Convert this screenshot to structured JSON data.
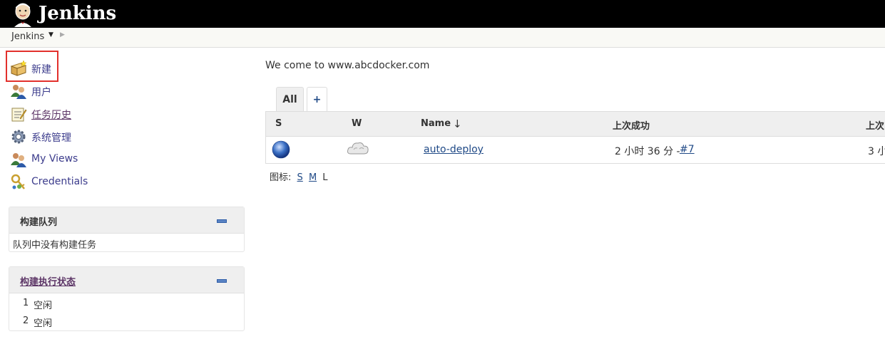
{
  "header": {
    "brand": "Jenkins",
    "logo_icon": "jenkins-butler-logo"
  },
  "breadcrumb": {
    "home": "Jenkins"
  },
  "tasks": [
    {
      "label": "新建",
      "icon": "new-item-icon"
    },
    {
      "label": "用户",
      "icon": "users-icon"
    },
    {
      "label": "任务历史",
      "icon": "notepad-icon"
    },
    {
      "label": "系统管理",
      "icon": "gear-icon"
    },
    {
      "label": "My Views",
      "icon": "users-icon"
    },
    {
      "label": "Credentials",
      "icon": "keys-icon"
    }
  ],
  "build_queue": {
    "title": "构建队列",
    "empty_message": "队列中没有构建任务"
  },
  "executors": {
    "title": "构建执行状态",
    "items": [
      {
        "num": "1",
        "status": "空闲"
      },
      {
        "num": "2",
        "status": "空闲"
      }
    ]
  },
  "main": {
    "description": "We come to www.abcdocker.com",
    "tabs": {
      "all": "All",
      "add": "+"
    },
    "table": {
      "headers": {
        "s": "S",
        "w": "W",
        "name": "Name",
        "sort_arrow": "↓",
        "last_success": "上次成功",
        "last_failure": "上次"
      },
      "rows": [
        {
          "name": "auto-deploy",
          "last_success_text": "2 小时 36 分 - ",
          "last_success_build": "#7",
          "last_failure": "3 小",
          "status_color": "#3a6fc4",
          "weather": "cloudy"
        }
      ]
    },
    "legend": {
      "label": "图标:",
      "sizes": [
        "S",
        "M",
        "L"
      ]
    }
  },
  "colors": {
    "header_bg": "#000000",
    "highlight": "#e2302c",
    "link": "#204a87"
  }
}
